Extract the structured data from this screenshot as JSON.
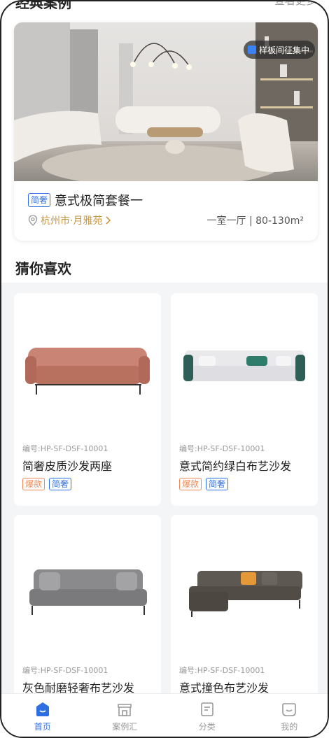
{
  "case_section": {
    "title": "经典案例",
    "more": "查看更多"
  },
  "case_card": {
    "badge": "样板间征集中",
    "tag": "简奢",
    "title": "意式极简套餐一",
    "location": "杭州市·月雅苑",
    "area": "一室一厅 | 80-130m²"
  },
  "recommend": {
    "title": "猜你喜欢",
    "products": [
      {
        "code": "编号:HP-SF-DSF-10001",
        "name": "简奢皮质沙发两座",
        "tags": [
          "爆款",
          "简奢"
        ],
        "color": "#c98476"
      },
      {
        "code": "编号:HP-SF-DSF-10001",
        "name": "意式简约绿白布艺沙发",
        "tags": [
          "爆款",
          "简奢"
        ],
        "color": "#e8e8ea"
      },
      {
        "code": "编号:HP-SF-DSF-10001",
        "name": "灰色耐磨轻奢布艺沙发",
        "tags": [],
        "color": "#8a8a8c"
      },
      {
        "code": "编号:HP-SF-DSF-10001",
        "name": "意式撞色布艺沙发",
        "tags": [],
        "color": "#5e5852"
      }
    ]
  },
  "tabbar": {
    "items": [
      {
        "label": "首页",
        "icon": "home-icon",
        "active": true
      },
      {
        "label": "案例汇",
        "icon": "store-icon",
        "active": false
      },
      {
        "label": "分类",
        "icon": "category-icon",
        "active": false
      },
      {
        "label": "我的",
        "icon": "profile-icon",
        "active": false
      }
    ]
  },
  "colors": {
    "accent": "#2f6fe4",
    "hot": "#f28a55",
    "location": "#c8963e"
  }
}
